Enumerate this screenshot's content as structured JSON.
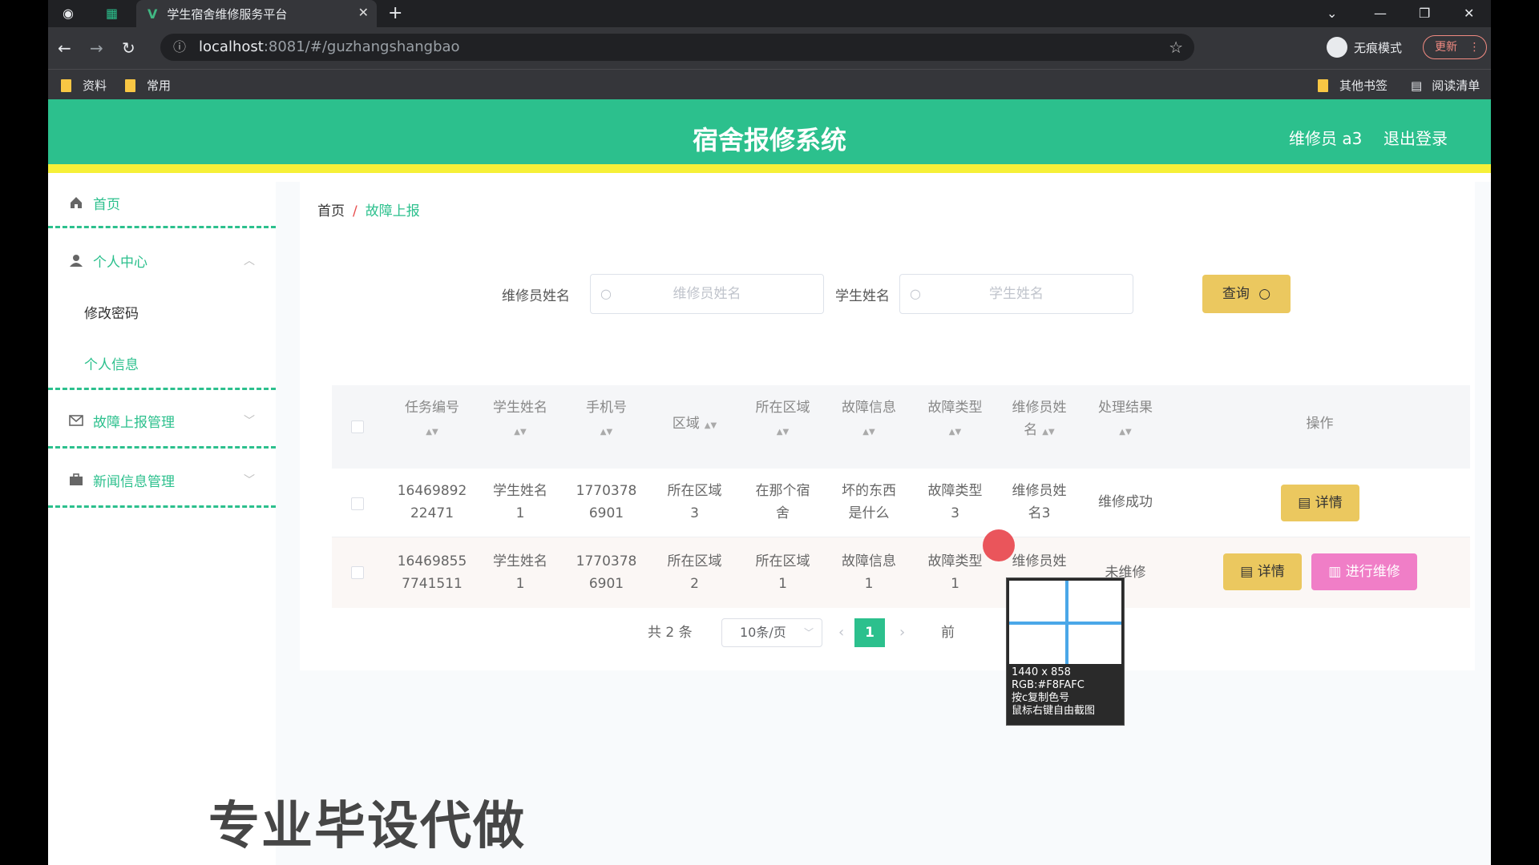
{
  "browser": {
    "tab_title": "学生宿舍维修服务平台",
    "url_host": "localhost",
    "url_path": ":8081/#/guzhangshangbao",
    "incognito_label": "无痕模式",
    "update_label": "更新",
    "bookmarks": [
      "资料",
      "常用"
    ],
    "bookmarks_right": [
      "其他书签",
      "阅读清单"
    ]
  },
  "header": {
    "title": "宿舍报修系统",
    "user": "维修员 a3",
    "logout": "退出登录"
  },
  "sidebar": {
    "home": "首页",
    "personal_center": "个人中心",
    "change_password": "修改密码",
    "personal_info": "个人信息",
    "fault_report_mgmt": "故障上报管理",
    "news_mgmt": "新闻信息管理"
  },
  "breadcrumb": {
    "home": "首页",
    "sep": "/",
    "current": "故障上报"
  },
  "search": {
    "repairer_label": "维修员姓名",
    "repairer_placeholder": "维修员姓名",
    "student_label": "学生姓名",
    "student_placeholder": "学生姓名",
    "query_button": "查询"
  },
  "table": {
    "headers": [
      "任务编号",
      "学生姓名",
      "手机号",
      "区域",
      "所在区域",
      "故障信息",
      "故障类型",
      "维修员姓名",
      "处理结果",
      "操作"
    ],
    "header_repairer_line1": "维修员姓",
    "header_repairer_line2": "名",
    "rows": [
      {
        "task_no_1": "16469892",
        "task_no_2": "22471",
        "student_1": "学生姓名",
        "student_2": "1",
        "phone_1": "1770378",
        "phone_2": "6901",
        "area_1": "所在区域",
        "area_2": "3",
        "location_1": "在那个宿",
        "location_2": "舍",
        "fault_info_1": "坏的东西",
        "fault_info_2": "是什么",
        "fault_type_1": "故障类型",
        "fault_type_2": "3",
        "repairer_1": "维修员姓",
        "repairer_2": "名3",
        "result": "维修成功",
        "btn_detail": "详情"
      },
      {
        "task_no_1": "16469855",
        "task_no_2": "7741511",
        "student_1": "学生姓名",
        "student_2": "1",
        "phone_1": "1770378",
        "phone_2": "6901",
        "area_1": "所在区域",
        "area_2": "2",
        "location_1": "所在区域",
        "location_2": "1",
        "fault_info_1": "故障信息",
        "fault_info_2": "1",
        "fault_type_1": "故障类型",
        "fault_type_2": "1",
        "repairer_1": "维修员姓",
        "result": "未维修",
        "btn_detail": "详情",
        "btn_repair": "进行维修"
      }
    ]
  },
  "pagination": {
    "total": "共 2 条",
    "page_size": "10条/页",
    "current_page": "1",
    "goto_fragment": "前"
  },
  "color_picker": {
    "size": "1440 x 858",
    "rgb": "RGB:#F8FAFC",
    "hint1": "按c复制色号",
    "hint2": "鼠标右键自由截图"
  },
  "watermark": "专业毕设代做",
  "colors": {
    "primary": "#2cc08d",
    "accent_yellow": "#f6f038",
    "button_gold": "#ebc85f",
    "button_pink": "#f07ec7"
  }
}
